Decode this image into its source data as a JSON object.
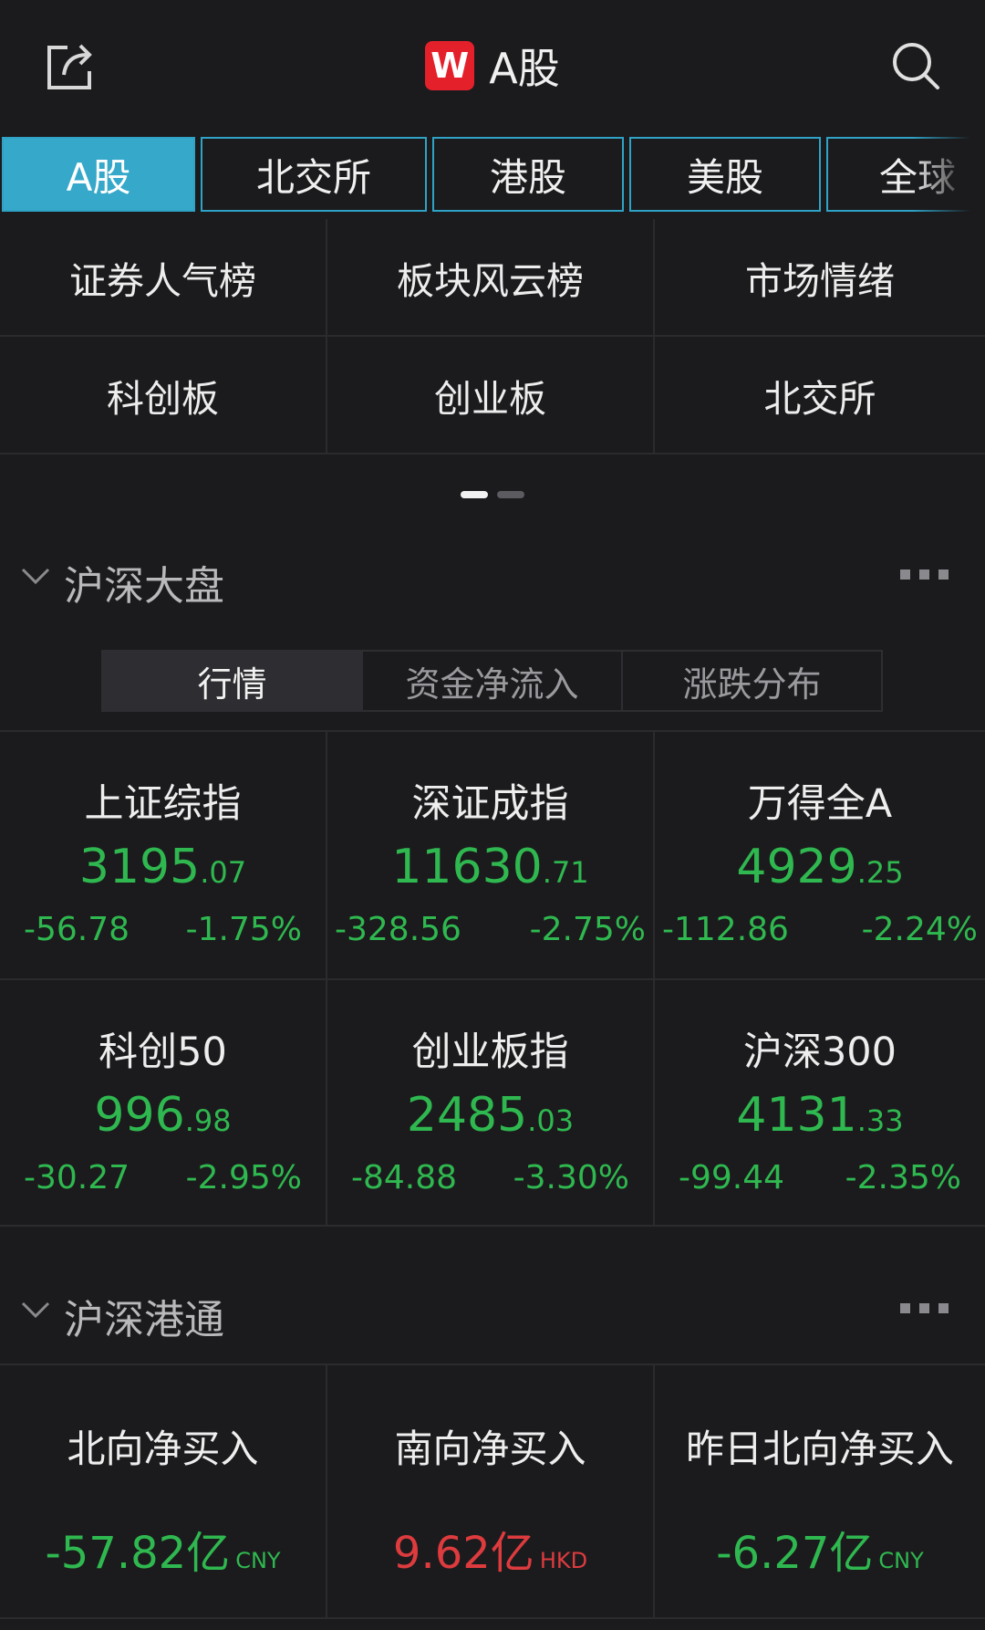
{
  "header": {
    "logo_letter": "W",
    "title": "A股",
    "icons": {
      "share": "share-icon",
      "search": "search-icon"
    }
  },
  "market_tabs": [
    {
      "label": "A股",
      "active": true,
      "width": 0
    },
    {
      "label": "北交所",
      "active": false
    },
    {
      "label": "港股",
      "active": false
    },
    {
      "label": "美股",
      "active": false
    },
    {
      "label": "全球",
      "active": false
    }
  ],
  "shortcuts": [
    "证券人气榜",
    "板块风云榜",
    "市场情绪",
    "科创板",
    "创业板",
    "北交所"
  ],
  "page_indicator": {
    "pages": 2,
    "current": 1
  },
  "section_hs": {
    "title": "沪深大盘",
    "tabs": [
      {
        "label": "行情",
        "active": true
      },
      {
        "label": "资金净流入",
        "active": false
      },
      {
        "label": "涨跌分布",
        "active": false
      }
    ],
    "indices": [
      {
        "name": "上证综指",
        "int": "3195",
        "dec": ".07",
        "change": "-56.78",
        "pct": "-1.75%"
      },
      {
        "name": "深证成指",
        "int": "11630",
        "dec": ".71",
        "change": "-328.56",
        "pct": "-2.75%"
      },
      {
        "name": "万得全A",
        "int": "4929",
        "dec": ".25",
        "change": "-112.86",
        "pct": "-2.24%"
      },
      {
        "name": "科创50",
        "int": "996",
        "dec": ".98",
        "change": "-30.27",
        "pct": "-2.95%"
      },
      {
        "name": "创业板指",
        "int": "2485",
        "dec": ".03",
        "change": "-84.88",
        "pct": "-3.30%"
      },
      {
        "name": "沪深300",
        "int": "4131",
        "dec": ".33",
        "change": "-99.44",
        "pct": "-2.35%"
      }
    ]
  },
  "section_connect": {
    "title": "沪深港通",
    "items": [
      {
        "name": "北向净买入",
        "value": "-57.82亿",
        "unit": "CNY",
        "color": "#2fb84f"
      },
      {
        "name": "南向净买入",
        "value": "9.62亿",
        "unit": "HKD",
        "color": "#dd3b3e"
      },
      {
        "name": "昨日北向净买入",
        "value": "-6.27亿",
        "unit": "CNY",
        "color": "#2fb84f"
      }
    ]
  },
  "colors": {
    "accent": "#36a8c9",
    "down": "#2fb84f",
    "up": "#dd3b3e",
    "background": "#1b1b1d"
  }
}
